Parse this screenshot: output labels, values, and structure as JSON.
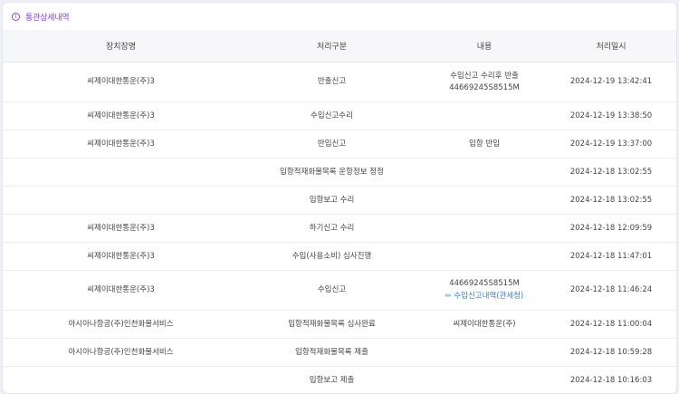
{
  "section": {
    "title": "통관상세내역",
    "icon": "info-icon"
  },
  "table": {
    "columns": [
      "장치장명",
      "처리구분",
      "내용",
      "처리일시"
    ],
    "rows": [
      {
        "storage": "씨제이대한통운(주)3",
        "type": "반출신고",
        "content": [
          "수입신고 수리후 반출",
          "44669245S8515M"
        ],
        "datetime": "2024-12-19 13:42:41"
      },
      {
        "storage": "씨제이대한통운(주)3",
        "type": "수입신고수리",
        "content": [],
        "datetime": "2024-12-19 13:38:50"
      },
      {
        "storage": "씨제이대한통운(주)3",
        "type": "반입신고",
        "content": [
          "입항 반입"
        ],
        "datetime": "2024-12-19 13:37:00"
      },
      {
        "storage": "",
        "type": "입항적재화물목록 운항정보 정정",
        "content": [],
        "datetime": "2024-12-18 13:02:55"
      },
      {
        "storage": "",
        "type": "입항보고 수리",
        "content": [],
        "datetime": "2024-12-18 13:02:55"
      },
      {
        "storage": "씨제이대한통운(주)3",
        "type": "하기신고 수리",
        "content": [],
        "datetime": "2024-12-18 12:09:59"
      },
      {
        "storage": "씨제이대한통운(주)3",
        "type": "수입(사용소비) 심사진행",
        "content": [],
        "datetime": "2024-12-18 11:47:01"
      },
      {
        "storage": "씨제이대한통운(주)3",
        "type": "수입신고",
        "content": [
          "44669245S8515M"
        ],
        "link": "수입신고내역(관세청)",
        "datetime": "2024-12-18 11:46:24"
      },
      {
        "storage": "아시아나항공(주)인천화물서비스",
        "type": "입항적재화물목록 심사완료",
        "content": [
          "씨제이대한통운(주)"
        ],
        "datetime": "2024-12-18 11:00:04"
      },
      {
        "storage": "아시아나항공(주)인천화물서비스",
        "type": "입항적재화물목록 제출",
        "content": [],
        "datetime": "2024-12-18 10:59:28"
      },
      {
        "storage": "",
        "type": "입항보고 제출",
        "content": [],
        "datetime": "2024-12-18 10:16:03"
      }
    ]
  }
}
